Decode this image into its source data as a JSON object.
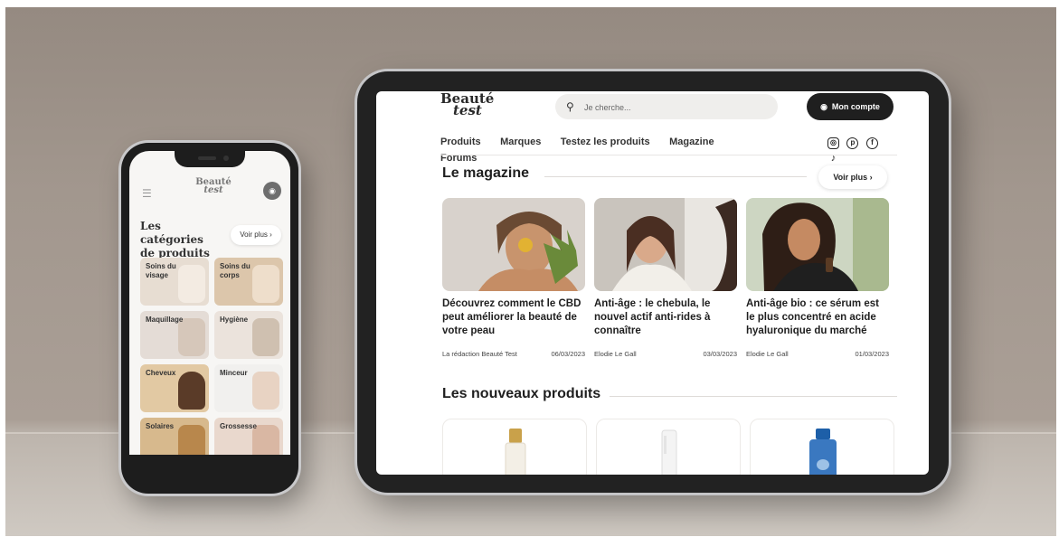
{
  "colors": {
    "wall": "#a2978e",
    "dark": "#1f1f1f",
    "accent_blue": "#3a78c0"
  },
  "phone": {
    "logo_line1": "Beauté",
    "logo_line2": "test",
    "menu_icon": "hamburger-icon",
    "account_icon": "user-icon",
    "categories_title": "Les catégories de produits",
    "voir_plus": "Voir plus ›",
    "categories": [
      {
        "label": "Soins du visage"
      },
      {
        "label": "Soins du corps"
      },
      {
        "label": "Maquillage"
      },
      {
        "label": "Hygiène"
      },
      {
        "label": "Cheveux"
      },
      {
        "label": "Minceur"
      },
      {
        "label": "Solaires"
      },
      {
        "label": "Grossesse"
      }
    ]
  },
  "tablet": {
    "logo_line1": "Beauté",
    "logo_line2": "test",
    "search_placeholder": "Je cherche...",
    "account_button": "Mon compte",
    "nav": [
      "Produits",
      "Marques",
      "Testez les produits",
      "Magazine",
      "Forums"
    ],
    "social_icons": [
      "instagram-icon",
      "pinterest-icon",
      "facebook-icon",
      "tiktok-icon"
    ],
    "magazine_title": "Le magazine",
    "voir_plus": "Voir plus ›",
    "articles": [
      {
        "title": "Découvrez comment le CBD peut améliorer la beauté de votre peau",
        "author": "La rédaction Beauté Test",
        "date": "06/03/2023"
      },
      {
        "title": "Anti-âge : le chebula, le nouvel actif anti-rides à connaître",
        "author": "Elodie Le Gall",
        "date": "03/03/2023"
      },
      {
        "title": "Anti-âge bio : ce sérum est le plus concentré en acide hyaluronique du marché",
        "author": "Elodie Le Gall",
        "date": "01/03/2023"
      }
    ],
    "products_title": "Les nouveaux produits"
  }
}
